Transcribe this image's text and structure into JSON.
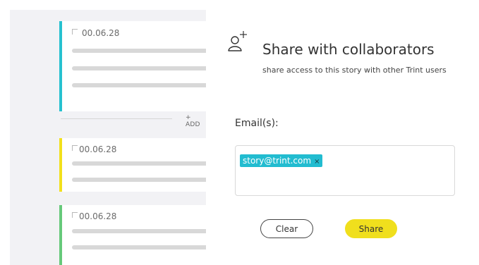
{
  "cards": [
    {
      "timestamp": "00.06.28",
      "accent": "#26c1cf"
    },
    {
      "timestamp": "00.06.28",
      "accent": "#f2e01c"
    },
    {
      "timestamp": "00.06.28",
      "accent": "#66c97a"
    }
  ],
  "divider": {
    "add_label": "+ ADD"
  },
  "modal": {
    "icon": "user-plus-icon",
    "title": "Share with collaborators",
    "subtitle": "share access to this story with other Trint users",
    "email_label": "Email(s):",
    "emails": [
      "story@trint.com"
    ],
    "remove_symbol": "×",
    "clear_label": "Clear",
    "share_label": "Share"
  },
  "colors": {
    "accent_cyan": "#26c1cf",
    "accent_yellow": "#f0df1d",
    "accent_green": "#66c97a"
  }
}
